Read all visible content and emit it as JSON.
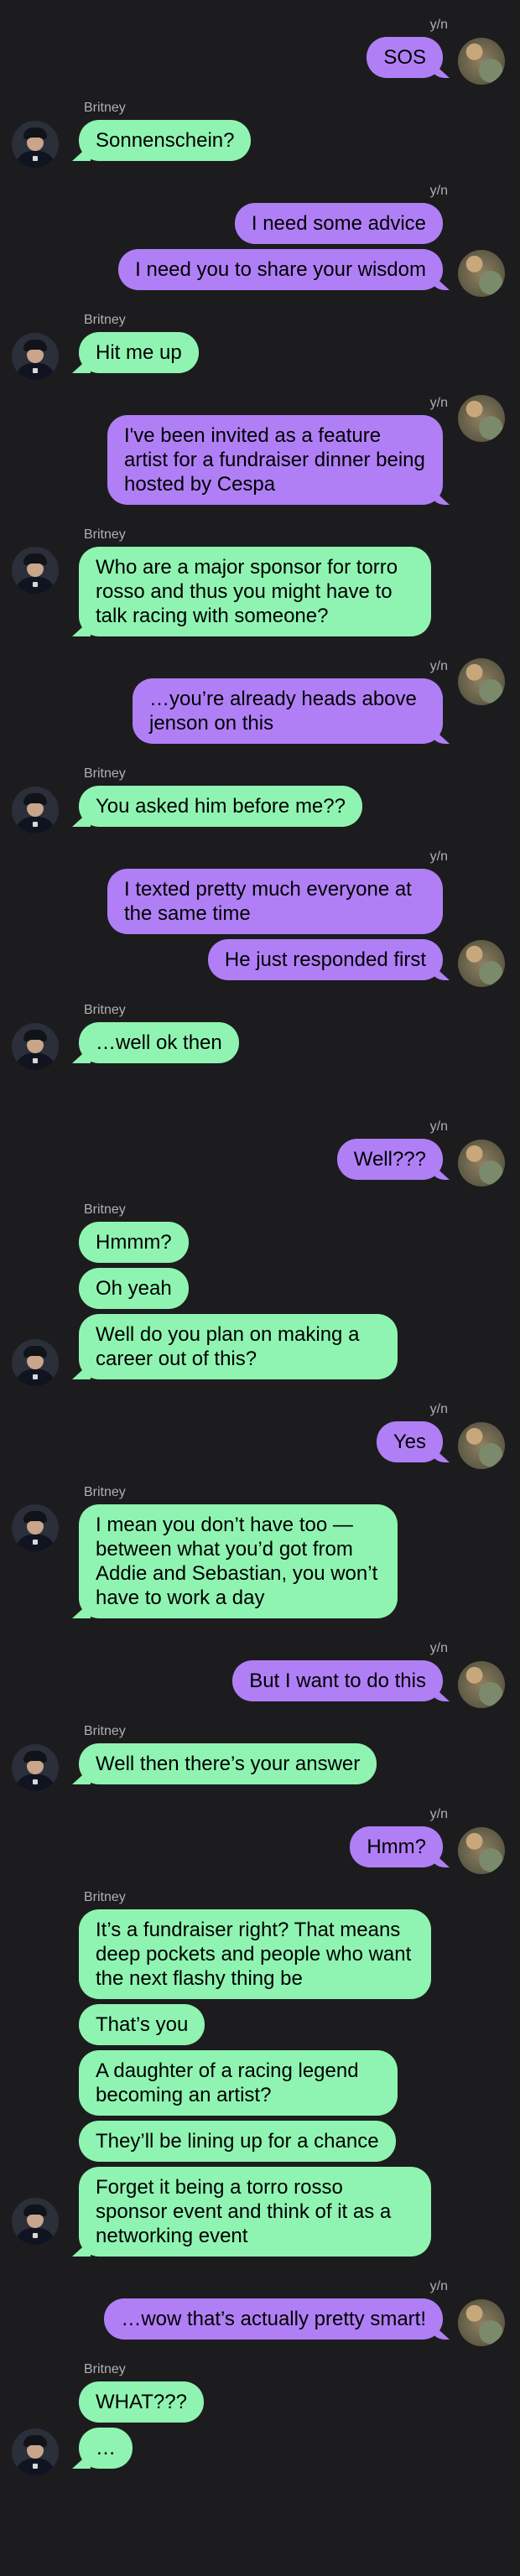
{
  "messages": {
    "g1": {
      "sender": "y/n",
      "lines": [
        "SOS"
      ]
    },
    "g2": {
      "sender": "Britney",
      "lines": [
        "Sonnenschein?"
      ]
    },
    "g3": {
      "sender": "y/n",
      "lines": [
        "I need some advice",
        "I need you to share your wisdom"
      ]
    },
    "g4": {
      "sender": "Britney",
      "lines": [
        "Hit me up"
      ]
    },
    "g5": {
      "sender": "y/n",
      "lines": [
        "I've been invited as a feature artist for a fundraiser dinner being hosted by Cespa"
      ]
    },
    "g6": {
      "sender": "Britney",
      "lines": [
        "Who are a major sponsor for torro rosso and thus you might have to talk racing with someone?"
      ]
    },
    "g7": {
      "sender": "y/n",
      "lines": [
        "…you’re already heads above jenson on this"
      ]
    },
    "g8": {
      "sender": "Britney",
      "lines": [
        "You asked him before me??"
      ]
    },
    "g9": {
      "sender": "y/n",
      "lines": [
        "I texted pretty much everyone at the same time",
        "He just responded first"
      ]
    },
    "g10": {
      "sender": "Britney",
      "lines": [
        "…well ok then"
      ]
    },
    "g11": {
      "sender": "y/n",
      "lines": [
        "Well???"
      ]
    },
    "g12": {
      "sender": "Britney",
      "lines": [
        "Hmmm?",
        "Oh yeah",
        "Well do you plan on making a career out of this?"
      ]
    },
    "g13": {
      "sender": "y/n",
      "lines": [
        "Yes"
      ]
    },
    "g14": {
      "sender": "Britney",
      "lines": [
        "I mean you don’t have too — between what you’d got from Addie and Sebastian, you won’t have to work a day"
      ]
    },
    "g15": {
      "sender": "y/n",
      "lines": [
        "But I want to do this"
      ]
    },
    "g16": {
      "sender": "Britney",
      "lines": [
        "Well then there’s your answer"
      ]
    },
    "g17": {
      "sender": "y/n",
      "lines": [
        "Hmm?"
      ]
    },
    "g18": {
      "sender": "Britney",
      "lines": [
        "It’s a fundraiser right? That means deep pockets and people who want the next flashy thing be",
        "That’s you",
        "A daughter of a racing legend becoming an artist?",
        "They’ll be lining up for a chance",
        "Forget it being a torro rosso sponsor event and think of it as a networking event"
      ]
    },
    "g19": {
      "sender": "y/n",
      "lines": [
        "…wow that’s actually pretty smart!"
      ]
    },
    "g20": {
      "sender": "Britney",
      "lines": [
        "WHAT???",
        "…"
      ]
    }
  },
  "colors": {
    "background": "#1c1c1e",
    "outgoing_bubble": "#b07ff6",
    "incoming_bubble": "#8ff4b1",
    "sender_name": "#b0b0b4"
  }
}
